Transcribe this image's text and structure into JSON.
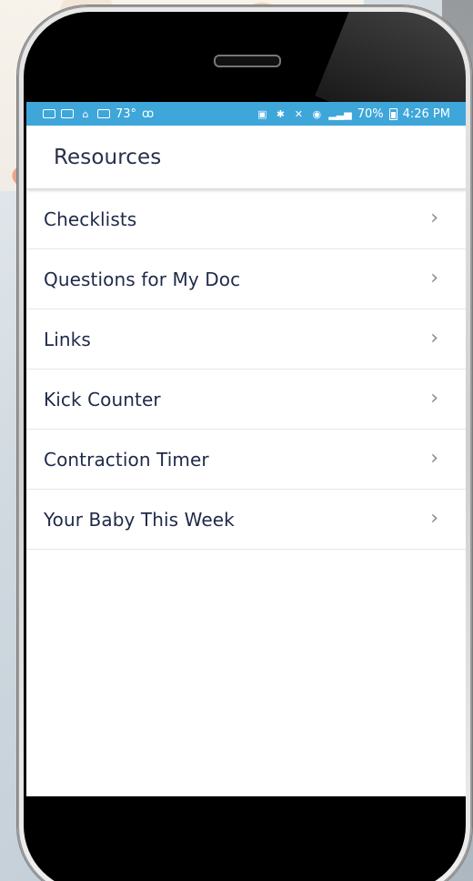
{
  "status_bar": {
    "temperature": "73°",
    "voicemail": "ꝏ",
    "battery_percent": "70%",
    "time": "4:26 PM"
  },
  "header": {
    "title": "Resources"
  },
  "menu": [
    {
      "label": "Checklists"
    },
    {
      "label": "Questions for My Doc"
    },
    {
      "label": "Links"
    },
    {
      "label": "Kick Counter"
    },
    {
      "label": "Contraction Timer"
    },
    {
      "label": "Your Baby This Week"
    }
  ],
  "icons": {
    "chevron": "chevron-right-icon"
  },
  "colors": {
    "status_bar": "#3ea6d9",
    "title_text": "#28304b",
    "menu_text": "#1f2a49",
    "chevron": "#8d8d8d"
  }
}
